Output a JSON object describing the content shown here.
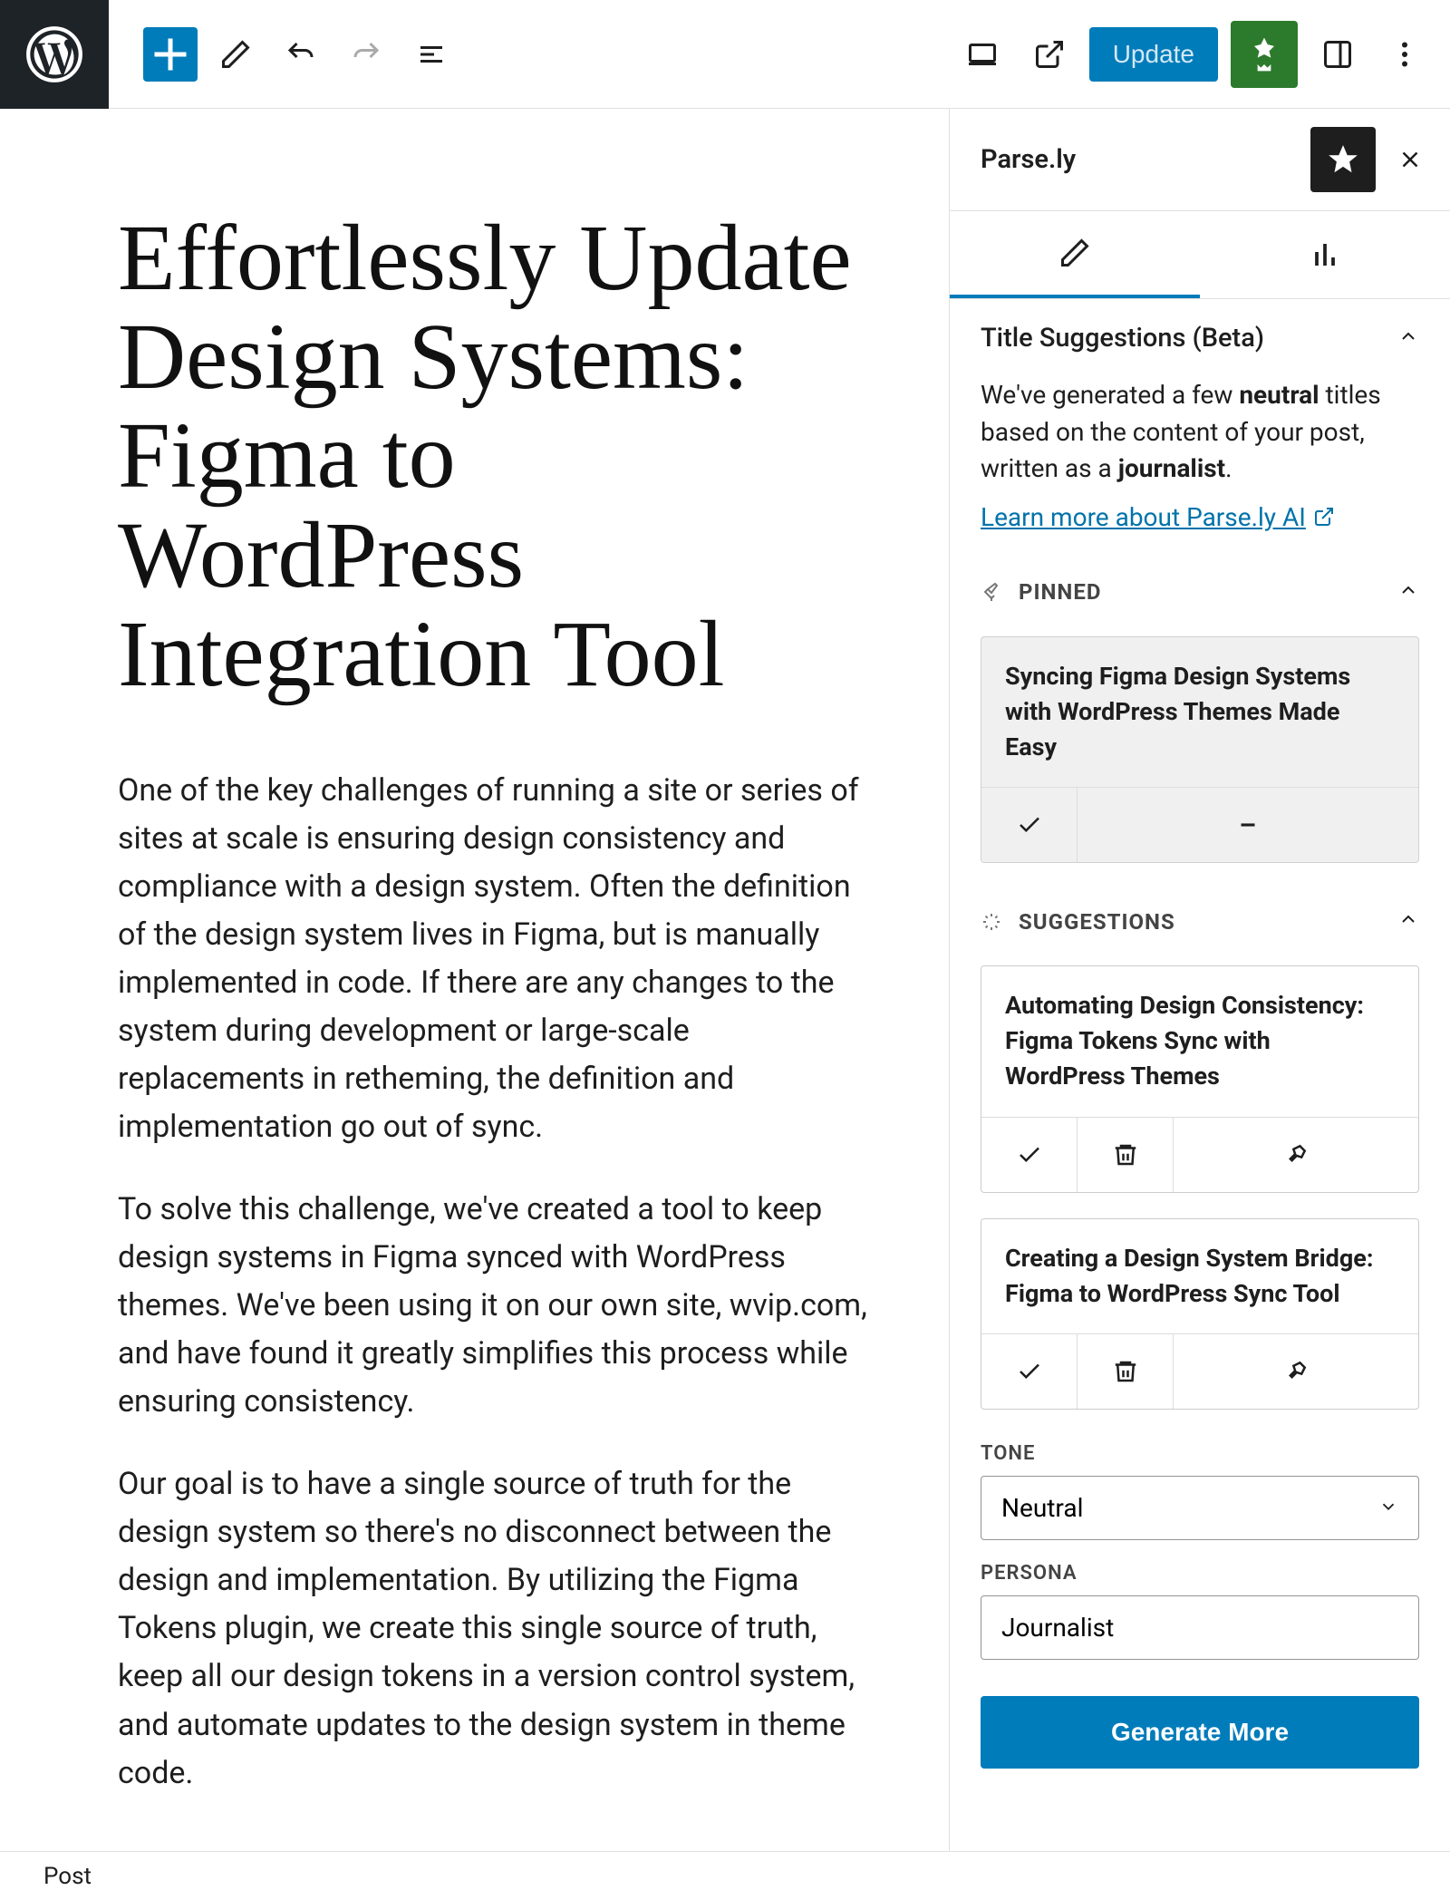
{
  "toolbar": {
    "update_label": "Update"
  },
  "post": {
    "title": "Effortlessly Update Design Systems: Figma to WordPress Integration Tool",
    "paragraphs": [
      "One of the key challenges of running a site or series of sites at scale is ensuring design consistency and compliance with a design system. Often the definition of the design system lives in Figma, but is manually implemented in code. If there are any changes to the system during development or large-scale replacements in retheming, the definition and implementation go out of sync.",
      "To solve this challenge, we've created a tool to keep design systems in Figma synced with WordPress themes. We've been using it on our own site, wvip.com, and have found it greatly simplifies this process while ensuring consistency.",
      "Our goal is to have a single source of truth for the design system so there's no disconnect between the design and implementation. By utilizing the Figma Tokens plugin, we create this single source of truth, keep all our design tokens in a version control system, and automate updates to the design system in theme code."
    ]
  },
  "panel": {
    "title": "Parse.ly",
    "section_title": "Title Suggestions (Beta)",
    "desc_prefix": "We've generated a few ",
    "desc_bold1": "neutral",
    "desc_middle": " titles based on the content of your post, written as a ",
    "desc_bold2": "journalist",
    "desc_suffix": ".",
    "learn_more": "Learn more about Parse.ly AI",
    "pinned_label": "PINNED",
    "suggestions_label": "SUGGESTIONS",
    "pinned_item": "Syncing Figma Design Systems with WordPress Themes Made Easy",
    "suggestions": [
      "Automating Design Consistency: Figma Tokens Sync with WordPress Themes",
      "Creating a Design System Bridge: Figma to WordPress Sync Tool"
    ],
    "tone_label": "TONE",
    "tone_value": "Neutral",
    "persona_label": "PERSONA",
    "persona_value": "Journalist",
    "generate_label": "Generate More"
  },
  "footer": {
    "breadcrumb": "Post"
  }
}
